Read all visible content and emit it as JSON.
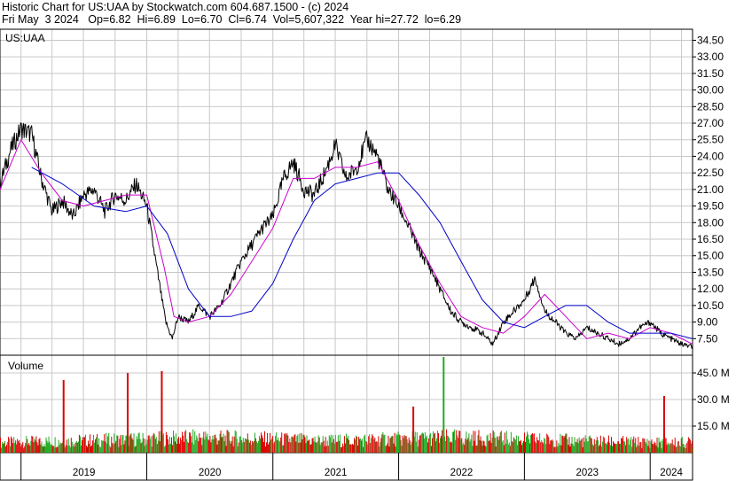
{
  "header": {
    "line1": "Historic Chart for US:UAA by Stockwatch.com 604.687.1500 - (c) 2024",
    "line2": "Fri May  3 2024   Op=6.82  Hi=6.89  Lo=6.70  Cl=6.74  Vol=5,607,322  Year hi=27.72  lo=6.29"
  },
  "colors": {
    "price": "#000000",
    "ma_short": "#cc00cc",
    "ma_long": "#0000cc",
    "volume_up": "#22aa22",
    "volume_down": "#dd0000",
    "grid": "#c8c8c8"
  },
  "chart_data": [
    {
      "type": "line",
      "title": "US:UAA",
      "y_ticks": [
        "34.50",
        "33.00",
        "31.50",
        "30.00",
        "28.50",
        "27.00",
        "25.50",
        "24.00",
        "22.50",
        "21.00",
        "19.50",
        "18.00",
        "16.50",
        "15.00",
        "13.50",
        "12.00",
        "10.50",
        "9.00",
        "7.50"
      ],
      "ylim": [
        6.0,
        35.5
      ],
      "x_labels": [
        "2019",
        "2020",
        "2021",
        "2022",
        "2023",
        "2024"
      ],
      "x_range": [
        "2018-11-01",
        "2024-05-03"
      ],
      "grid": true,
      "series": [
        {
          "role": "price",
          "x": [
            "2018-11-01",
            "2018-12-01",
            "2019-01-01",
            "2019-02-01",
            "2019-03-01",
            "2019-04-01",
            "2019-05-01",
            "2019-06-01",
            "2019-07-01",
            "2019-08-01",
            "2019-09-01",
            "2019-10-01",
            "2019-11-01",
            "2019-12-01",
            "2020-01-01",
            "2020-02-01",
            "2020-02-25",
            "2020-03-15",
            "2020-04-01",
            "2020-05-01",
            "2020-06-01",
            "2020-07-01",
            "2020-08-01",
            "2020-09-01",
            "2020-10-01",
            "2020-11-01",
            "2020-12-01",
            "2021-01-01",
            "2021-02-01",
            "2021-03-01",
            "2021-04-01",
            "2021-05-01",
            "2021-06-01",
            "2021-07-01",
            "2021-08-01",
            "2021-09-01",
            "2021-10-01",
            "2021-11-01",
            "2021-12-01",
            "2022-01-01",
            "2022-02-01",
            "2022-03-01",
            "2022-04-01",
            "2022-05-01",
            "2022-06-01",
            "2022-07-01",
            "2022-08-01",
            "2022-09-01",
            "2022-10-01",
            "2022-11-01",
            "2022-12-01",
            "2023-01-01",
            "2023-02-01",
            "2023-03-01",
            "2023-04-01",
            "2023-05-01",
            "2023-06-01",
            "2023-07-01",
            "2023-08-01",
            "2023-09-01",
            "2023-10-01",
            "2023-11-01",
            "2023-12-01",
            "2024-01-01",
            "2024-02-01",
            "2024-03-01",
            "2024-04-01",
            "2024-05-03"
          ],
          "values": [
            21.5,
            24.5,
            26.5,
            26.0,
            22.0,
            19.0,
            20.0,
            18.5,
            20.5,
            21.0,
            19.0,
            20.5,
            20.0,
            21.5,
            19.5,
            13.5,
            9.0,
            7.5,
            9.5,
            9.0,
            10.5,
            9.5,
            10.5,
            12.5,
            14.5,
            16.0,
            17.5,
            18.5,
            22.0,
            23.5,
            21.0,
            20.5,
            22.5,
            25.0,
            22.0,
            23.0,
            25.5,
            24.0,
            21.0,
            19.5,
            17.5,
            15.5,
            14.0,
            12.0,
            10.0,
            9.0,
            8.5,
            8.0,
            7.0,
            9.0,
            10.0,
            11.0,
            13.0,
            10.0,
            9.0,
            8.0,
            7.5,
            8.5,
            8.0,
            7.5,
            7.0,
            7.5,
            8.5,
            9.0,
            8.0,
            7.5,
            7.0,
            6.74
          ]
        },
        {
          "role": "moving-average-short",
          "x": [
            "2018-11-01",
            "2019-01-01",
            "2019-03-01",
            "2019-05-01",
            "2019-07-01",
            "2019-09-01",
            "2019-11-01",
            "2020-01-01",
            "2020-02-20",
            "2020-03-20",
            "2020-05-01",
            "2020-07-01",
            "2020-09-01",
            "2020-11-01",
            "2021-01-01",
            "2021-03-01",
            "2021-05-01",
            "2021-07-01",
            "2021-09-01",
            "2021-11-01",
            "2022-01-01",
            "2022-03-01",
            "2022-05-01",
            "2022-07-01",
            "2022-09-01",
            "2022-11-01",
            "2023-01-01",
            "2023-03-01",
            "2023-05-01",
            "2023-07-01",
            "2023-09-01",
            "2023-11-01",
            "2024-01-01",
            "2024-03-01",
            "2024-05-03"
          ],
          "values": [
            21.0,
            25.5,
            22.5,
            20.0,
            19.5,
            20.0,
            20.5,
            20.5,
            14.0,
            9.5,
            9.0,
            9.5,
            11.5,
            14.5,
            17.5,
            22.0,
            22.0,
            23.0,
            23.0,
            23.5,
            20.0,
            16.0,
            12.5,
            9.5,
            8.5,
            8.0,
            9.5,
            11.5,
            9.5,
            7.5,
            8.0,
            7.5,
            8.5,
            8.0,
            7.0
          ]
        },
        {
          "role": "moving-average-long",
          "x": [
            "2019-02-01",
            "2019-05-01",
            "2019-08-01",
            "2019-11-01",
            "2020-01-01",
            "2020-03-01",
            "2020-05-01",
            "2020-07-01",
            "2020-09-01",
            "2020-11-01",
            "2021-01-01",
            "2021-03-01",
            "2021-05-01",
            "2021-07-01",
            "2021-09-01",
            "2021-11-01",
            "2022-01-01",
            "2022-03-01",
            "2022-05-01",
            "2022-07-01",
            "2022-09-01",
            "2022-11-01",
            "2023-01-01",
            "2023-03-01",
            "2023-05-01",
            "2023-07-01",
            "2023-09-01",
            "2023-11-01",
            "2024-01-01",
            "2024-03-01",
            "2024-05-03"
          ],
          "values": [
            23.0,
            21.5,
            19.5,
            19.0,
            19.5,
            17.0,
            12.0,
            9.5,
            9.5,
            10.0,
            12.5,
            16.5,
            20.0,
            21.5,
            22.0,
            22.5,
            22.5,
            20.5,
            18.0,
            14.5,
            11.0,
            9.0,
            8.5,
            9.5,
            10.5,
            10.5,
            9.0,
            8.0,
            8.0,
            8.0,
            7.5
          ]
        }
      ]
    },
    {
      "type": "bar",
      "title": "Volume",
      "y_ticks": [
        "45.0 M",
        "30.0 M",
        "15.0 M"
      ],
      "ylim": [
        0,
        55
      ],
      "unit": "M",
      "spikes": {
        "x": [
          "2019-05-02",
          "2019-11-04",
          "2020-02-11",
          "2022-05-09",
          "2022-02-10",
          "2024-02-08"
        ],
        "values": [
          41,
          45,
          46,
          54,
          26,
          32
        ],
        "colors": [
          "down",
          "down",
          "down",
          "up",
          "down",
          "down"
        ]
      },
      "baseline_by_month": {
        "x": [
          "2018-11-01",
          "2019-06-01",
          "2020-01-01",
          "2020-06-01",
          "2021-01-01",
          "2021-06-01",
          "2022-01-01",
          "2022-06-01",
          "2023-01-01",
          "2023-06-01",
          "2024-01-01",
          "2024-05-03"
        ],
        "values": [
          6,
          7,
          8,
          9,
          8,
          7,
          8,
          9,
          8,
          7,
          6,
          6
        ]
      }
    }
  ]
}
